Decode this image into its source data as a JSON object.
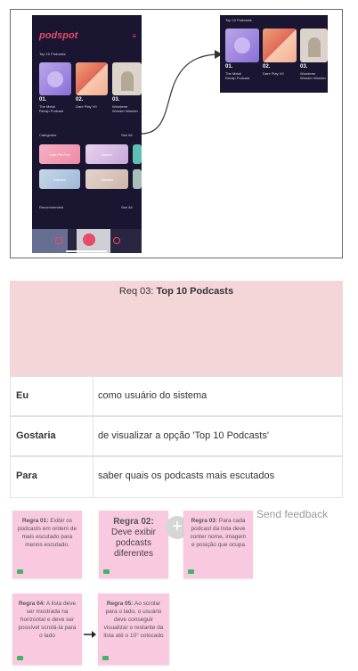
{
  "app": {
    "logo": "podspot",
    "top10_title": "Top 10 Podcasts",
    "top10_items": [
      {
        "rank": "01.",
        "line1": "The Metal",
        "line2": "Recap Podcast"
      },
      {
        "rank": "02.",
        "line1": "Dare Play VII",
        "line2": ""
      },
      {
        "rank": "03.",
        "line1": "Wonderer",
        "line2": "Wonder Wander"
      }
    ],
    "categories_title": "Categories",
    "see_all": "See All",
    "categories": [
      "Lost Pet Pod",
      "Nature",
      "Science",
      "Lifestyle"
    ],
    "recommended_title": "Recommended",
    "colors": {
      "bg": "#1a1530",
      "accent": "#e84a6a"
    }
  },
  "requirement": {
    "prefix": "Req 03:",
    "title": "Top 10 Podcasts",
    "rows": [
      {
        "key": "Eu",
        "value": "como usuário do sistema"
      },
      {
        "key": "Gostaria",
        "value": "de visualizar a opção 'Top 10 Podcasts'"
      },
      {
        "key": "Para",
        "value": "saber quais os podcasts mais escutados"
      }
    ]
  },
  "notes": [
    {
      "title": "Regra 01:",
      "text": "Exibir os podcasts em ordem de mais escutado para menos escutado."
    },
    {
      "title": "Regra 02:",
      "text": "Deve exibir podcasts diferentes"
    },
    {
      "title": "Regra 03:",
      "text": "Para cada podcast da lista deve conter nome, imagem e posição que ocupa"
    },
    {
      "title": "Regra 04:",
      "text": "A lista deve ser mostrada na horizontal e deve ser possível scrolá-la para o lado"
    },
    {
      "title": "Regra 05:",
      "text": "Ao scrolar para o lado, o usuário deve conseguir visualizar o restante da lista até o 10° colocado"
    }
  ],
  "feedback": "Send feedback",
  "icons": {
    "add": "plus-icon",
    "arrow": "arrow-right-icon"
  }
}
